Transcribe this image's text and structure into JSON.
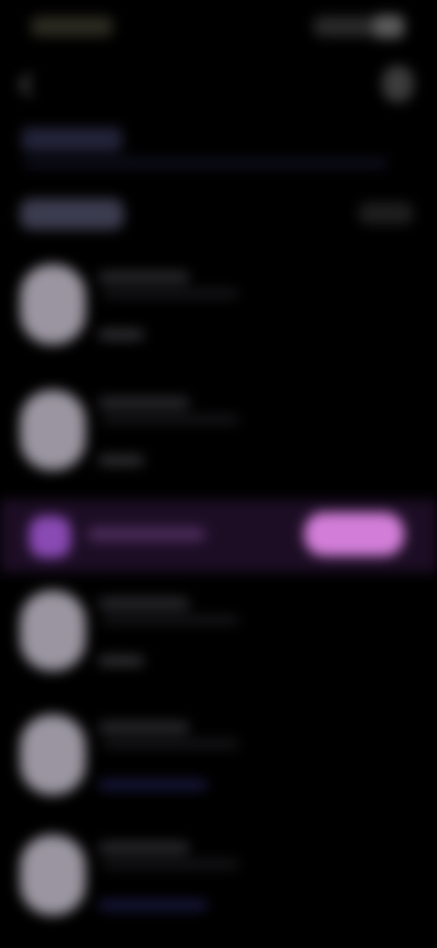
{
  "status_bar": {
    "time": "",
    "icons": [
      "signal-icon",
      "wifi-icon",
      "battery-icon"
    ]
  },
  "toolbar": {
    "back_icon": "back-arrow-icon",
    "more_icon": "more-icon"
  },
  "header": {
    "title": "",
    "subtitle": ""
  },
  "section": {
    "label": "",
    "action_label": ""
  },
  "contacts": [
    {
      "name": "",
      "detail": "",
      "meta": ""
    },
    {
      "name": "",
      "detail": "",
      "meta": ""
    },
    {
      "name": "",
      "detail": "",
      "meta": ""
    },
    {
      "name": "",
      "detail": "",
      "meta": ""
    },
    {
      "name": "",
      "detail": "",
      "meta": ""
    }
  ],
  "highlight": {
    "label": "",
    "button_label": "",
    "accent_color": "#d27ed8"
  },
  "colors": {
    "background": "#000000",
    "avatar": "#9a95a0",
    "accent": "#d27ed8",
    "accent_dark": "#8a4ab4",
    "link_blue": "#1a1a46"
  }
}
